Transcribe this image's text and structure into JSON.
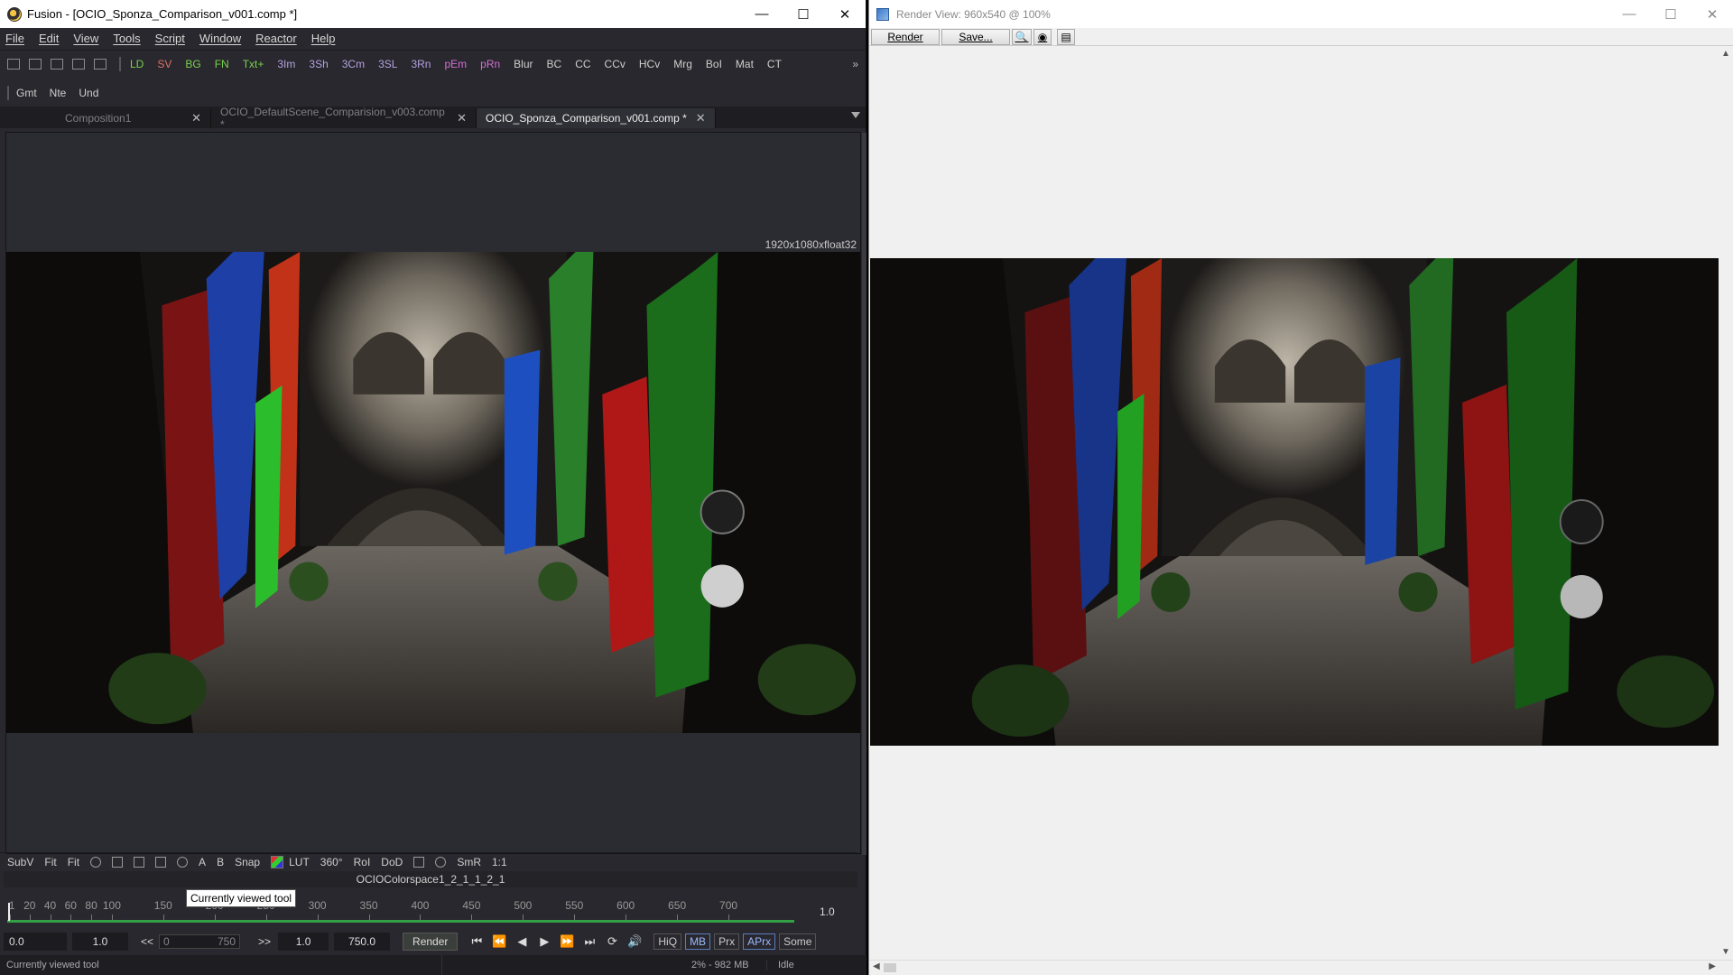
{
  "fusion": {
    "title": "Fusion - [OCIO_Sponza_Comparison_v001.comp *]",
    "window_controls": {
      "minimize": "—",
      "maximize": "☐",
      "close": "✕"
    },
    "menu": [
      "File",
      "Edit",
      "View",
      "Tools",
      "Script",
      "Window",
      "Reactor",
      "Help"
    ],
    "toolbar": [
      {
        "label": "LD",
        "color": "#7cd04e"
      },
      {
        "label": "SV",
        "color": "#e0706a"
      },
      {
        "label": "BG",
        "color": "#7cd04e"
      },
      {
        "label": "FN",
        "color": "#7cd04e"
      },
      {
        "label": "Txt+",
        "color": "#7cd04e"
      },
      {
        "label": "3Im",
        "color": "#b6a2e0"
      },
      {
        "label": "3Sh",
        "color": "#b6a2e0"
      },
      {
        "label": "3Cm",
        "color": "#b6a2e0"
      },
      {
        "label": "3SL",
        "color": "#b6a2e0"
      },
      {
        "label": "3Rn",
        "color": "#b6a2e0"
      },
      {
        "label": "pEm",
        "color": "#d66fd0"
      },
      {
        "label": "pRn",
        "color": "#d66fd0"
      },
      {
        "label": "Blur",
        "color": "#cfcfcf"
      },
      {
        "label": "BC",
        "color": "#cfcfcf"
      },
      {
        "label": "CC",
        "color": "#cfcfcf"
      },
      {
        "label": "CCv",
        "color": "#cfcfcf"
      },
      {
        "label": "HCv",
        "color": "#cfcfcf"
      },
      {
        "label": "Mrg",
        "color": "#cfcfcf"
      },
      {
        "label": "BoI",
        "color": "#cfcfcf"
      },
      {
        "label": "Mat",
        "color": "#cfcfcf"
      },
      {
        "label": "CT",
        "color": "#cfcfcf"
      }
    ],
    "toolbar_overflow": "»",
    "toolbar2": [
      "Gmt",
      "Nte",
      "Und"
    ],
    "tabs": [
      {
        "label": "Composition1",
        "active": false
      },
      {
        "label": "OCIO_DefaultScene_Comparision_v003.comp *",
        "active": false
      },
      {
        "label": "OCIO_Sponza_Comparison_v001.comp *",
        "active": true
      }
    ],
    "tab_close": "✕",
    "viewer_resolution": "1920x1080xfloat32",
    "view_controls": {
      "subv": "SubV",
      "fit1": "Fit",
      "fit2": "Fit",
      "a": "A",
      "b": "B",
      "snap": "Snap",
      "lut": "LUT",
      "deg": "360°",
      "roi": "RoI",
      "dod": "DoD",
      "smr": "SmR",
      "one": "1:1"
    },
    "ocio_label": "OCIOColorspace1_2_1_1_2_1",
    "tooltip": "Currently viewed tool",
    "timeline": {
      "ticks": [
        1,
        20,
        40,
        60,
        80,
        100,
        150,
        200,
        250,
        300,
        350,
        400,
        450,
        500,
        550,
        600,
        650,
        700
      ],
      "end": 750,
      "value_right": "1.0"
    },
    "transport": {
      "global_start": "0.0",
      "render_start": "1.0",
      "prev": "<<",
      "range_start": "0",
      "range_end": "750",
      "next": ">>",
      "render_end": "1.0",
      "global_end": "750.0",
      "render_button": "Render",
      "quality": [
        "HiQ",
        "MB",
        "Prx",
        "APrx",
        "Some"
      ]
    },
    "status": {
      "left": "Currently viewed tool",
      "memory": "2% - 982 MB",
      "state": "Idle"
    }
  },
  "render_view": {
    "title": "Render View: 960x540 @ 100%",
    "window_controls": {
      "minimize": "—",
      "maximize": "☐",
      "close": "✕"
    },
    "buttons": {
      "render": "Render",
      "save": "Save..."
    }
  }
}
